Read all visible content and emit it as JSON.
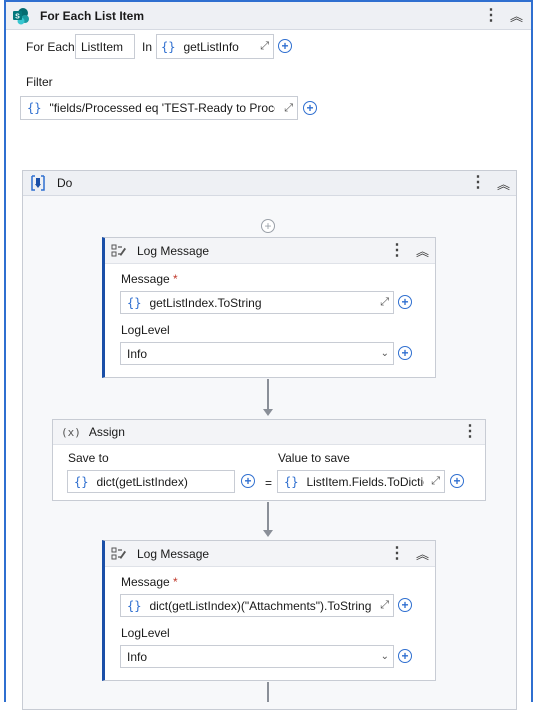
{
  "foreach": {
    "title": "For Each List Item",
    "for_each_label": "For Each",
    "item_var": "ListItem",
    "in_label": "In",
    "collection": "getListInfo",
    "filter_label": "Filter",
    "filter_value": "\"fields/Processed eq 'TEST-Ready to Proces"
  },
  "do_block": {
    "title": "Do"
  },
  "log1": {
    "title": "Log Message",
    "message_label": "Message",
    "required_mark": "*",
    "message_value": "getListIndex.ToString",
    "loglevel_label": "LogLevel",
    "loglevel_value": "Info"
  },
  "assign": {
    "title": "Assign",
    "icon_text": "(x)",
    "save_to_label": "Save to",
    "save_to_value": "dict(getListIndex)",
    "equals": "=",
    "value_label": "Value to save",
    "value_value": "ListItem.Fields.ToDictio"
  },
  "log2": {
    "title": "Log Message",
    "message_label": "Message",
    "required_mark": "*",
    "message_value": "dict(getListIndex)(\"Attachments\").ToString",
    "loglevel_label": "LogLevel",
    "loglevel_value": "Info"
  },
  "glyphs": {
    "braces": "{}",
    "kebab": "⋮",
    "collapse": "︽",
    "expand": "⤢",
    "plus": "+",
    "chevron": "⌄"
  },
  "colors": {
    "accent": "#2f6fd0",
    "header_bg": "#eef0f4",
    "brand_sharepoint": "#0b6a6b"
  }
}
